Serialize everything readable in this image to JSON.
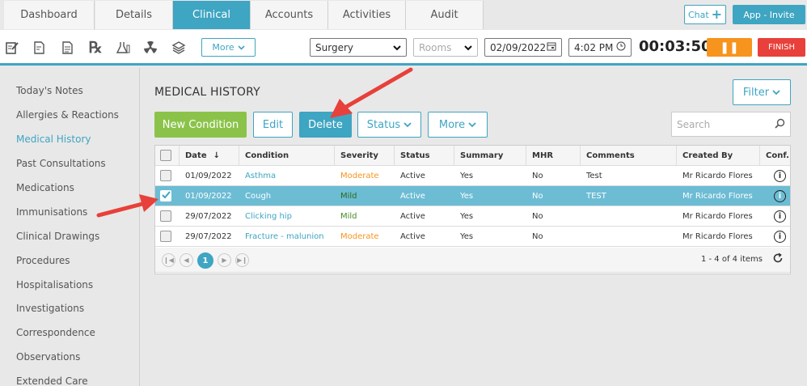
{
  "tabs": [
    {
      "label": "Dashboard"
    },
    {
      "label": "Details"
    },
    {
      "label": "Clinical"
    },
    {
      "label": "Accounts"
    },
    {
      "label": "Activities"
    },
    {
      "label": "Audit"
    }
  ],
  "header": {
    "chat_label": "Chat",
    "chat_plus": "+",
    "app_invite_label": "App - Invite"
  },
  "toolbar": {
    "more_label": "More",
    "location_value": "Surgery",
    "rooms_placeholder": "Rooms",
    "date_value": "02/09/2022",
    "time_value": "4:02 PM",
    "timer_value": "00:03:50",
    "pause_label": "❚❚",
    "finish_label": "FINISH"
  },
  "sidebar": {
    "items": [
      {
        "label": "Today's Notes"
      },
      {
        "label": "Allergies & Reactions"
      },
      {
        "label": "Medical History"
      },
      {
        "label": "Past Consultations"
      },
      {
        "label": "Medications"
      },
      {
        "label": "Immunisations"
      },
      {
        "label": "Clinical Drawings"
      },
      {
        "label": "Procedures"
      },
      {
        "label": "Hospitalisations"
      },
      {
        "label": "Investigations"
      },
      {
        "label": "Correspondence"
      },
      {
        "label": "Observations"
      },
      {
        "label": "Extended Care"
      }
    ]
  },
  "main": {
    "title": "MEDICAL HISTORY",
    "filter_label": "Filter",
    "new_condition_label": "New Condition",
    "edit_label": "Edit",
    "delete_label": "Delete",
    "status_label": "Status",
    "more_label": "More",
    "search_placeholder": "Search"
  },
  "grid": {
    "columns": [
      "Date",
      "Condition",
      "Severity",
      "Status",
      "Summary",
      "MHR",
      "Comments",
      "Created By",
      "Conf."
    ],
    "sort_indicator": "↓",
    "rows": [
      {
        "date": "01/09/2022",
        "condition": "Asthma",
        "severity": "Moderate",
        "status": "Active",
        "summary": "Yes",
        "mhr": "No",
        "comments": "Test",
        "created_by": "Mr Ricardo Flores",
        "checked": false
      },
      {
        "date": "01/09/2022",
        "condition": "Cough",
        "severity": "Mild",
        "status": "Active",
        "summary": "Yes",
        "mhr": "No",
        "comments": "TEST",
        "created_by": "Mr Ricardo Flores",
        "checked": true
      },
      {
        "date": "29/07/2022",
        "condition": "Clicking hip",
        "severity": "Mild",
        "status": "Active",
        "summary": "Yes",
        "mhr": "No",
        "comments": "",
        "created_by": "Mr Ricardo Flores",
        "checked": false
      },
      {
        "date": "29/07/2022",
        "condition": "Fracture - malunion",
        "severity": "Moderate",
        "status": "Active",
        "summary": "Yes",
        "mhr": "No",
        "comments": "",
        "created_by": "Mr Ricardo Flores",
        "checked": false
      }
    ],
    "pager": {
      "current_page": "1",
      "info": "1 - 4 of 4 items"
    }
  },
  "colors": {
    "accent": "#3ea5c2",
    "new_button": "#8bc34a",
    "pause": "#f7941d",
    "finish": "#e8403a",
    "moderate": "#f7941d",
    "mild": "#4a8a2a",
    "arrow": "#e8403a"
  }
}
